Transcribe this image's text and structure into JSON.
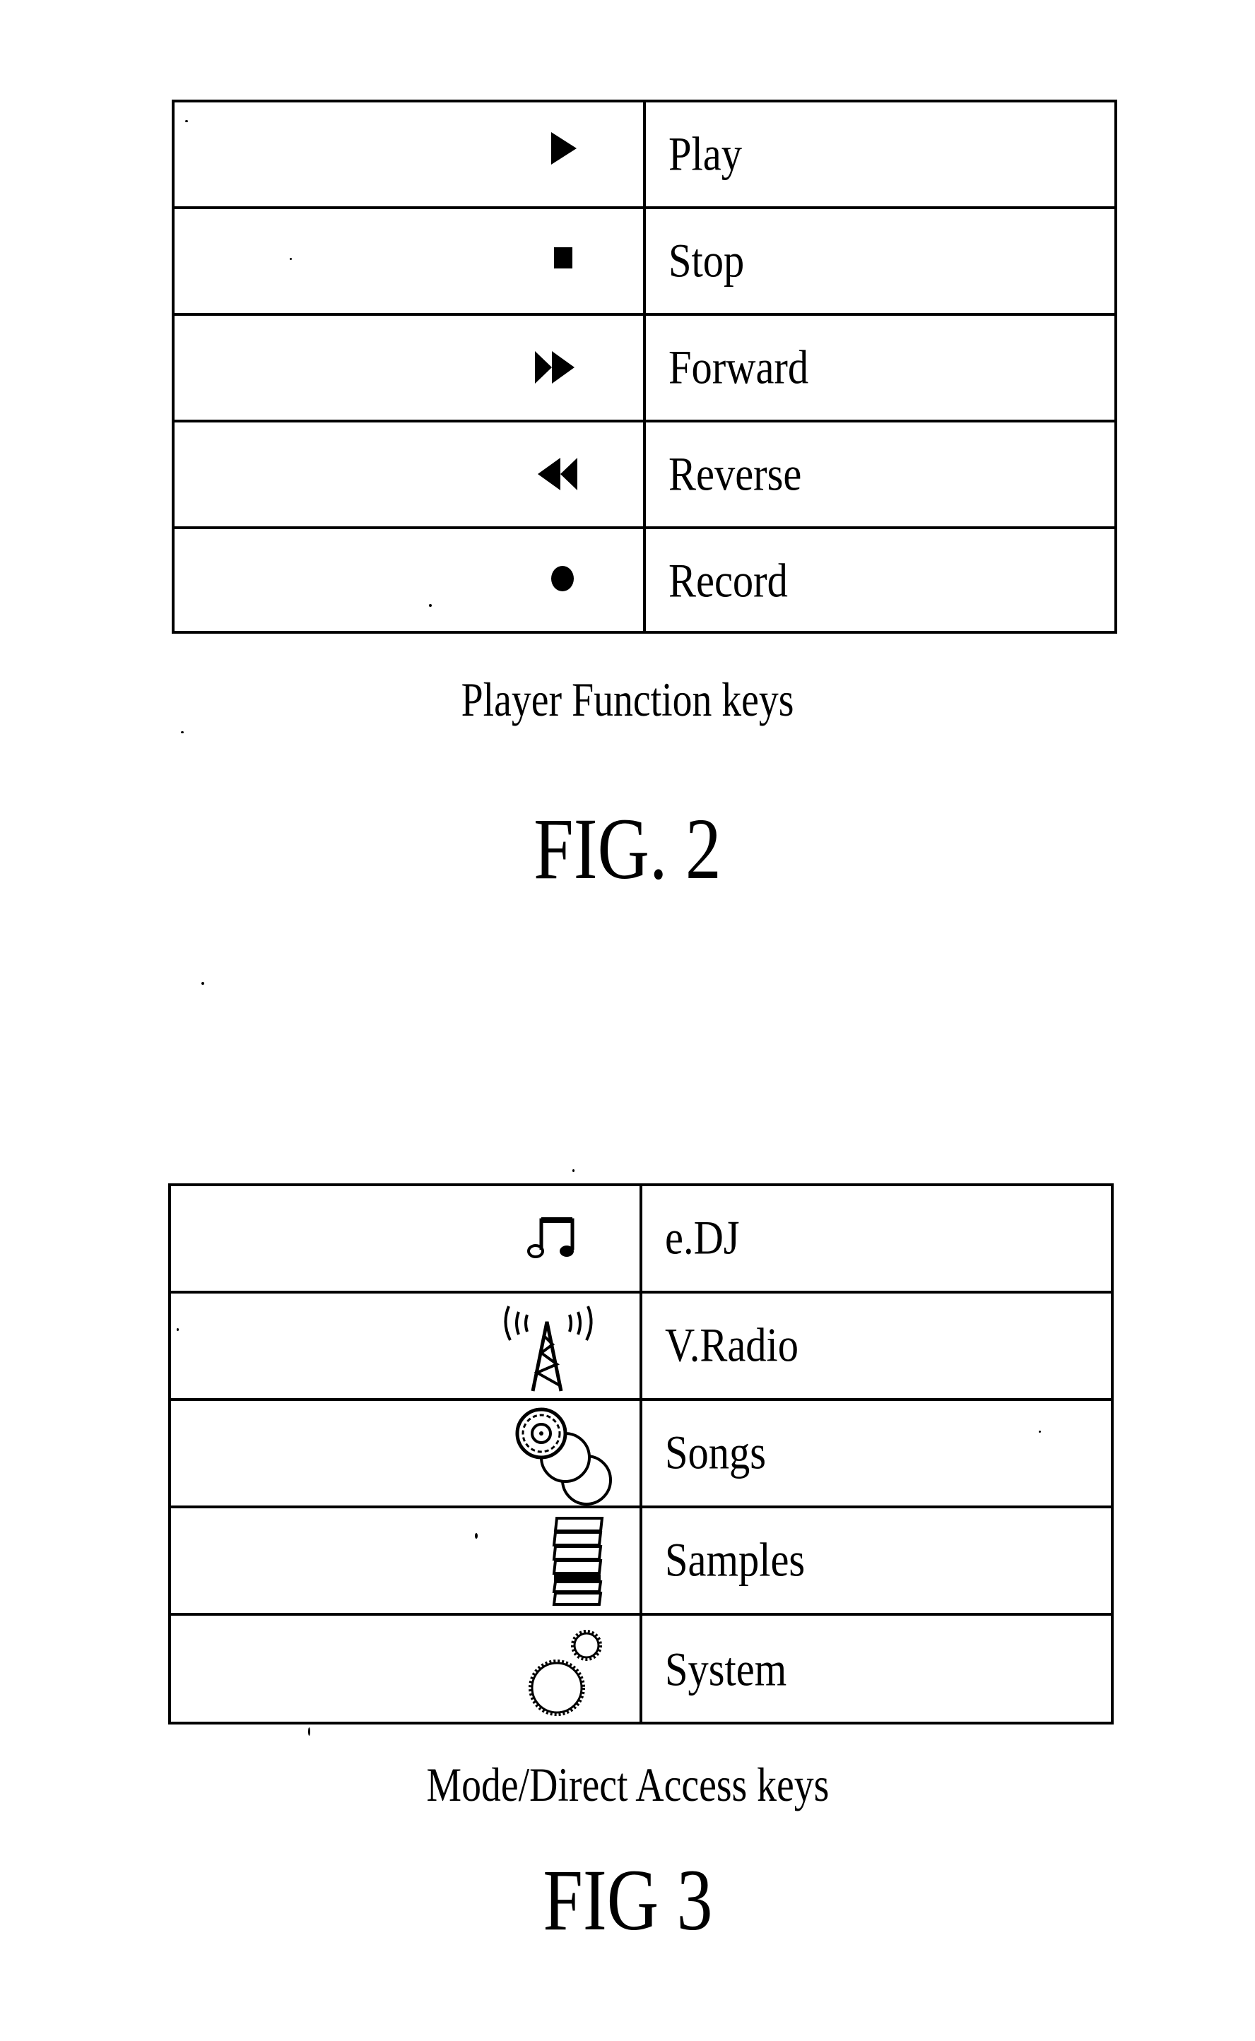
{
  "figures": [
    {
      "id": "fig2",
      "caption": "Player Function keys",
      "figure_label": "FIG. 2",
      "rows": [
        {
          "icon": "play-icon",
          "label": "Play"
        },
        {
          "icon": "stop-icon",
          "label": "Stop"
        },
        {
          "icon": "fast-forward-icon",
          "label": "Forward"
        },
        {
          "icon": "rewind-icon",
          "label": "Reverse"
        },
        {
          "icon": "record-icon",
          "label": "Record"
        }
      ]
    },
    {
      "id": "fig3",
      "caption": "Mode/Direct Access keys",
      "figure_label": "FIG 3",
      "rows": [
        {
          "icon": "music-note-icon",
          "label": "e.DJ"
        },
        {
          "icon": "radio-tower-icon",
          "label": "V.Radio"
        },
        {
          "icon": "discs-icon",
          "label": "Songs"
        },
        {
          "icon": "stacked-samples-icon",
          "label": "Samples"
        },
        {
          "icon": "gears-icon",
          "label": "System"
        }
      ]
    }
  ]
}
